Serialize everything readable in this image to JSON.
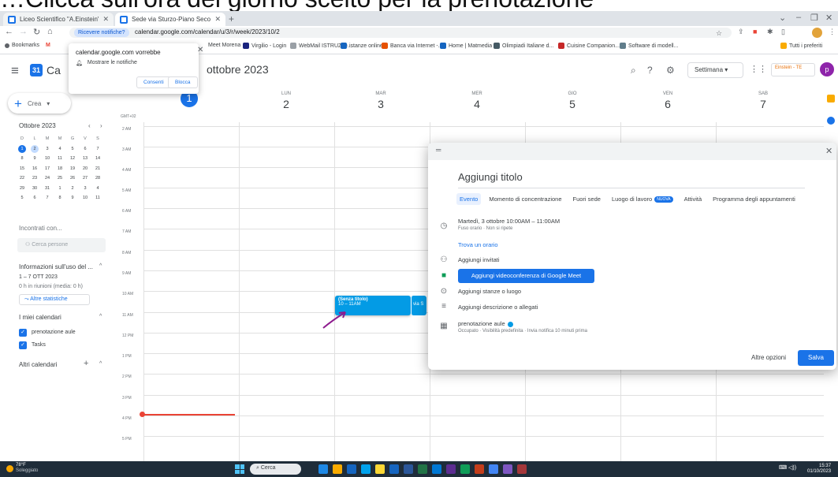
{
  "banner": {
    "text": "…Clicca sull'ora del giorno scelto per la prenotazione"
  },
  "browser": {
    "tabs": [
      {
        "label": "Liceo Scientifico \"A.Einstein\" - C..."
      },
      {
        "label": "Sede via Sturzo-Piano Secondo"
      }
    ],
    "notif_chip": "Ricevere notifiche?",
    "url": "calendar.google.com/calendar/u/3/r/week/2023/10/2",
    "bookmarks": [
      {
        "label": "Bookmarks",
        "color": "#5f6368"
      },
      {
        "label": "M",
        "color": "#ea4335"
      },
      {
        "label": "Meet Morena",
        "color": "#00897b"
      },
      {
        "label": "Virgilio - Login",
        "color": "#1a237e"
      },
      {
        "label": "WebMail ISTRUZIO...",
        "color": "#9aa0a6"
      },
      {
        "label": "istanze online",
        "color": "#1565c0"
      },
      {
        "label": "Banca via Internet -...",
        "color": "#e65100"
      },
      {
        "label": "Home | Matmedia",
        "color": "#1565c0"
      },
      {
        "label": "Olimpiadi Italiane d...",
        "color": "#455a64"
      },
      {
        "label": "Cuisine Companion...",
        "color": "#c62828"
      },
      {
        "label": "Software di modell...",
        "color": "#607d8b"
      },
      {
        "label": "Tutti i preferiti",
        "color": "#f9ab00"
      }
    ]
  },
  "notification_popup": {
    "title": "calendar.google.com vorrebbe",
    "row": "Mostrare le notifiche",
    "allow": "Consenti",
    "block": "Blocca"
  },
  "header": {
    "app_title": "Ca",
    "logo_day": "31",
    "month": "ottobre 2023",
    "view": "Settimana",
    "school_badge": "Einstein - TE",
    "avatar": "p"
  },
  "sidebar": {
    "create": "Crea",
    "mini_month": "Ottobre 2023",
    "weekday_initials": [
      "D",
      "L",
      "M",
      "M",
      "G",
      "V",
      "S"
    ],
    "weeks": [
      [
        "1",
        "2",
        "3",
        "4",
        "5",
        "6",
        "7"
      ],
      [
        "8",
        "9",
        "10",
        "11",
        "12",
        "13",
        "14"
      ],
      [
        "15",
        "16",
        "17",
        "18",
        "19",
        "20",
        "21"
      ],
      [
        "22",
        "23",
        "24",
        "25",
        "26",
        "27",
        "28"
      ],
      [
        "29",
        "30",
        "31",
        "1",
        "2",
        "3",
        "4"
      ],
      [
        "5",
        "6",
        "7",
        "8",
        "9",
        "10",
        "11"
      ]
    ],
    "meet_with": "Incontrati con...",
    "search_people": "Cerca persone",
    "time_insights": "Informazioni sull'uso del ...",
    "date_range": "1 – 7 OTT 2023",
    "meetings_stat": "0 h in riunioni (media: 0 h)",
    "more_stats": "Altre statistiche",
    "my_calendars": "I miei calendari",
    "calendars": [
      {
        "label": "prenotazione aule"
      },
      {
        "label": "Tasks"
      }
    ],
    "other_calendars": "Altri calendari"
  },
  "week": {
    "gmt": "GMT+02",
    "days": [
      {
        "dow": "",
        "num": "1",
        "today": true
      },
      {
        "dow": "LUN",
        "num": "2"
      },
      {
        "dow": "MAR",
        "num": "3"
      },
      {
        "dow": "MER",
        "num": "4"
      },
      {
        "dow": "GIO",
        "num": "5"
      },
      {
        "dow": "VEN",
        "num": "6"
      },
      {
        "dow": "SAB",
        "num": "7"
      }
    ],
    "hours": [
      "2 AM",
      "3 AM",
      "4 AM",
      "5 AM",
      "6 AM",
      "7 AM",
      "8 AM",
      "9 AM",
      "10 AM",
      "11 AM",
      "12 PM",
      "1 PM",
      "2 PM",
      "3 PM",
      "4 PM",
      "5 PM"
    ],
    "event": {
      "title": "(Senza titolo)",
      "time": "10 – 11AM",
      "neighbor": "via S"
    }
  },
  "dialog": {
    "title_placeholder": "Aggiungi titolo",
    "tabs": [
      "Evento",
      "Momento di concentrazione",
      "Fuori sede",
      "Luogo di lavoro",
      "Attività",
      "Programma degli appuntamenti"
    ],
    "new_badge": "NUOVA",
    "datetime": "Martedì, 3 ottobre   10:00AM  –  11:00AM",
    "datetime_sub": "Fuso orario · Non si ripete",
    "find_time": "Trova un orario",
    "add_guests": "Aggiungi invitati",
    "meet_button": "Aggiungi videoconferenza di Google Meet",
    "add_rooms": "Aggiungi stanze o luogo",
    "add_description": "Aggiungi descrizione o allegati",
    "calendar_name": "prenotazione aule",
    "calendar_sub": "Occupato · Visibilità predefinita · Invia notifica 10 minuti prima",
    "more_options": "Altre opzioni",
    "save": "Salva"
  },
  "taskbar": {
    "temperature": "78°F",
    "weather": "Soleggiato",
    "search": "Cerca",
    "time": "15:37",
    "date": "01/10/2023",
    "apps": [
      "#1e88e5",
      "#f9ab00",
      "#1565c0",
      "#00a2ed",
      "#fdd835",
      "#1565c0",
      "#2b579a",
      "#217346",
      "#0078d4",
      "#5c2d91",
      "#0f9d58",
      "#c43e1c",
      "#4285f4",
      "#7e57c2",
      "#a4373a"
    ]
  }
}
